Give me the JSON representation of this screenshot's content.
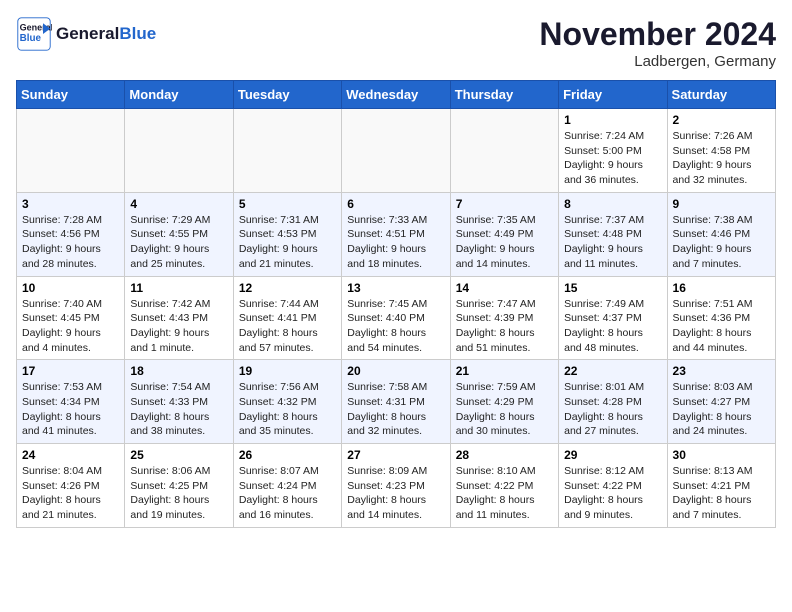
{
  "header": {
    "logo_line1": "General",
    "logo_line2": "Blue",
    "month": "November 2024",
    "location": "Ladbergen, Germany"
  },
  "weekdays": [
    "Sunday",
    "Monday",
    "Tuesday",
    "Wednesday",
    "Thursday",
    "Friday",
    "Saturday"
  ],
  "rows": [
    [
      {
        "day": "",
        "info": ""
      },
      {
        "day": "",
        "info": ""
      },
      {
        "day": "",
        "info": ""
      },
      {
        "day": "",
        "info": ""
      },
      {
        "day": "",
        "info": ""
      },
      {
        "day": "1",
        "info": "Sunrise: 7:24 AM\nSunset: 5:00 PM\nDaylight: 9 hours\nand 36 minutes."
      },
      {
        "day": "2",
        "info": "Sunrise: 7:26 AM\nSunset: 4:58 PM\nDaylight: 9 hours\nand 32 minutes."
      }
    ],
    [
      {
        "day": "3",
        "info": "Sunrise: 7:28 AM\nSunset: 4:56 PM\nDaylight: 9 hours\nand 28 minutes."
      },
      {
        "day": "4",
        "info": "Sunrise: 7:29 AM\nSunset: 4:55 PM\nDaylight: 9 hours\nand 25 minutes."
      },
      {
        "day": "5",
        "info": "Sunrise: 7:31 AM\nSunset: 4:53 PM\nDaylight: 9 hours\nand 21 minutes."
      },
      {
        "day": "6",
        "info": "Sunrise: 7:33 AM\nSunset: 4:51 PM\nDaylight: 9 hours\nand 18 minutes."
      },
      {
        "day": "7",
        "info": "Sunrise: 7:35 AM\nSunset: 4:49 PM\nDaylight: 9 hours\nand 14 minutes."
      },
      {
        "day": "8",
        "info": "Sunrise: 7:37 AM\nSunset: 4:48 PM\nDaylight: 9 hours\nand 11 minutes."
      },
      {
        "day": "9",
        "info": "Sunrise: 7:38 AM\nSunset: 4:46 PM\nDaylight: 9 hours\nand 7 minutes."
      }
    ],
    [
      {
        "day": "10",
        "info": "Sunrise: 7:40 AM\nSunset: 4:45 PM\nDaylight: 9 hours\nand 4 minutes."
      },
      {
        "day": "11",
        "info": "Sunrise: 7:42 AM\nSunset: 4:43 PM\nDaylight: 9 hours\nand 1 minute."
      },
      {
        "day": "12",
        "info": "Sunrise: 7:44 AM\nSunset: 4:41 PM\nDaylight: 8 hours\nand 57 minutes."
      },
      {
        "day": "13",
        "info": "Sunrise: 7:45 AM\nSunset: 4:40 PM\nDaylight: 8 hours\nand 54 minutes."
      },
      {
        "day": "14",
        "info": "Sunrise: 7:47 AM\nSunset: 4:39 PM\nDaylight: 8 hours\nand 51 minutes."
      },
      {
        "day": "15",
        "info": "Sunrise: 7:49 AM\nSunset: 4:37 PM\nDaylight: 8 hours\nand 48 minutes."
      },
      {
        "day": "16",
        "info": "Sunrise: 7:51 AM\nSunset: 4:36 PM\nDaylight: 8 hours\nand 44 minutes."
      }
    ],
    [
      {
        "day": "17",
        "info": "Sunrise: 7:53 AM\nSunset: 4:34 PM\nDaylight: 8 hours\nand 41 minutes."
      },
      {
        "day": "18",
        "info": "Sunrise: 7:54 AM\nSunset: 4:33 PM\nDaylight: 8 hours\nand 38 minutes."
      },
      {
        "day": "19",
        "info": "Sunrise: 7:56 AM\nSunset: 4:32 PM\nDaylight: 8 hours\nand 35 minutes."
      },
      {
        "day": "20",
        "info": "Sunrise: 7:58 AM\nSunset: 4:31 PM\nDaylight: 8 hours\nand 32 minutes."
      },
      {
        "day": "21",
        "info": "Sunrise: 7:59 AM\nSunset: 4:29 PM\nDaylight: 8 hours\nand 30 minutes."
      },
      {
        "day": "22",
        "info": "Sunrise: 8:01 AM\nSunset: 4:28 PM\nDaylight: 8 hours\nand 27 minutes."
      },
      {
        "day": "23",
        "info": "Sunrise: 8:03 AM\nSunset: 4:27 PM\nDaylight: 8 hours\nand 24 minutes."
      }
    ],
    [
      {
        "day": "24",
        "info": "Sunrise: 8:04 AM\nSunset: 4:26 PM\nDaylight: 8 hours\nand 21 minutes."
      },
      {
        "day": "25",
        "info": "Sunrise: 8:06 AM\nSunset: 4:25 PM\nDaylight: 8 hours\nand 19 minutes."
      },
      {
        "day": "26",
        "info": "Sunrise: 8:07 AM\nSunset: 4:24 PM\nDaylight: 8 hours\nand 16 minutes."
      },
      {
        "day": "27",
        "info": "Sunrise: 8:09 AM\nSunset: 4:23 PM\nDaylight: 8 hours\nand 14 minutes."
      },
      {
        "day": "28",
        "info": "Sunrise: 8:10 AM\nSunset: 4:22 PM\nDaylight: 8 hours\nand 11 minutes."
      },
      {
        "day": "29",
        "info": "Sunrise: 8:12 AM\nSunset: 4:22 PM\nDaylight: 8 hours\nand 9 minutes."
      },
      {
        "day": "30",
        "info": "Sunrise: 8:13 AM\nSunset: 4:21 PM\nDaylight: 8 hours\nand 7 minutes."
      }
    ]
  ]
}
